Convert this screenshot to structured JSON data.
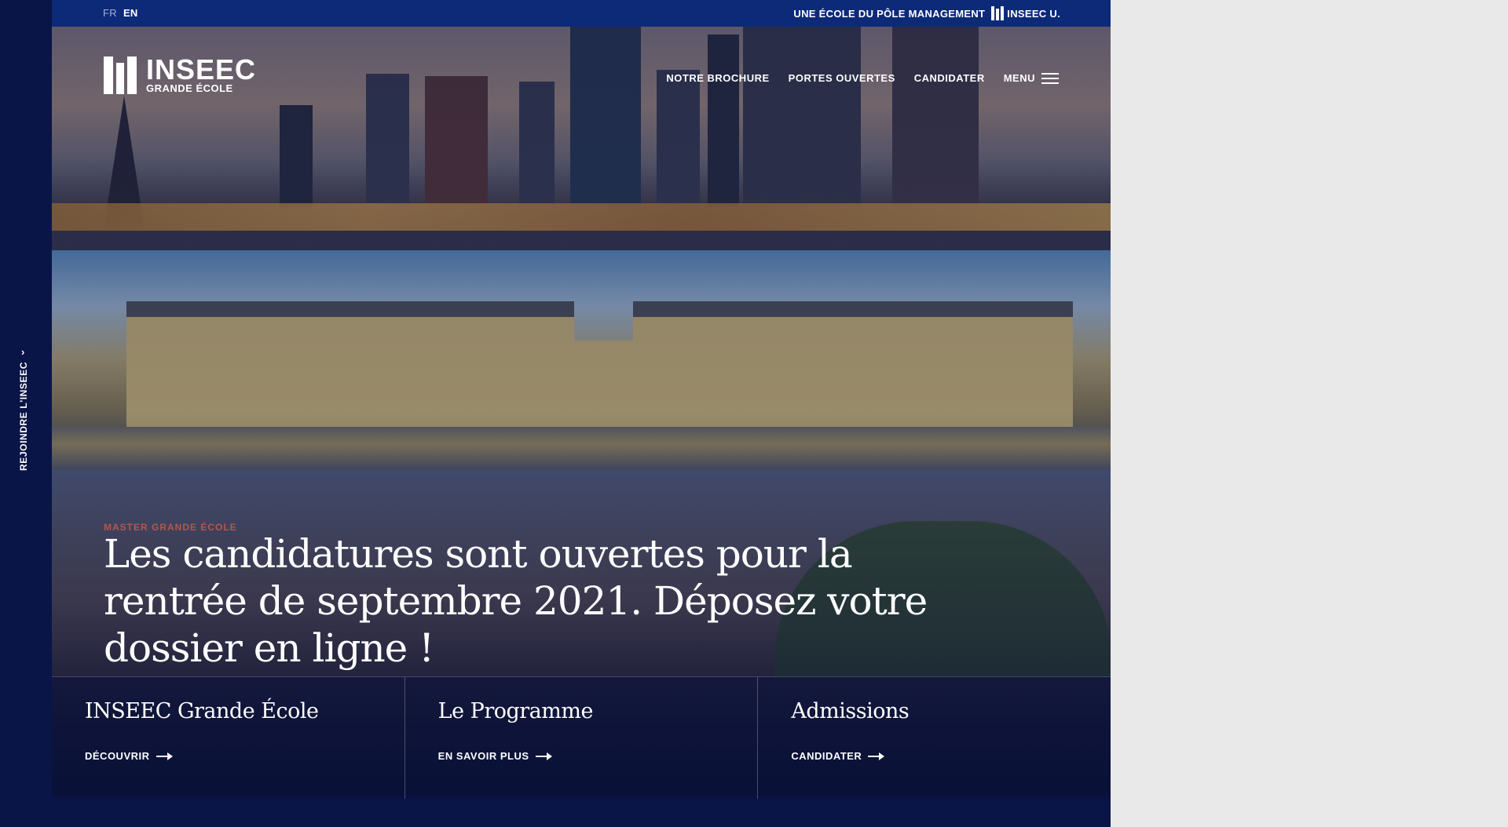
{
  "rail": {
    "label": "REJOINDRE L'INSEEC",
    "arrow": "›"
  },
  "topbar": {
    "lang_fr": "FR",
    "lang_en": "EN",
    "school_note": "UNE ÉCOLE DU PÔLE MANAGEMENT",
    "parent_brand": "INSEEC U."
  },
  "header": {
    "logo_main": "INSEEC",
    "logo_sub": "GRANDE ÉCOLE",
    "nav": [
      "NOTRE BROCHURE",
      "PORTES OUVERTES",
      "CANDIDATER"
    ],
    "menu_label": "MENU"
  },
  "hero": {
    "eyebrow": "MASTER GRANDE ÉCOLE",
    "headline": "Les candidatures sont ouvertes pour la rentrée de septembre 2021. Déposez votre dossier en ligne !"
  },
  "cards": [
    {
      "title": "INSEEC Grande École",
      "link": "DÉCOUVRIR"
    },
    {
      "title": "Le Programme",
      "link": "EN SAVOIR PLUS"
    },
    {
      "title": "Admissions",
      "link": "CANDIDATER"
    }
  ],
  "colors": {
    "navy": "#0a1547",
    "topbar": "#0d2a78",
    "accent": "#e0624a"
  },
  "icons": [
    "logo-mark-icon",
    "hamburger-icon",
    "arrow-right-icon",
    "chevron-right-icon"
  ]
}
